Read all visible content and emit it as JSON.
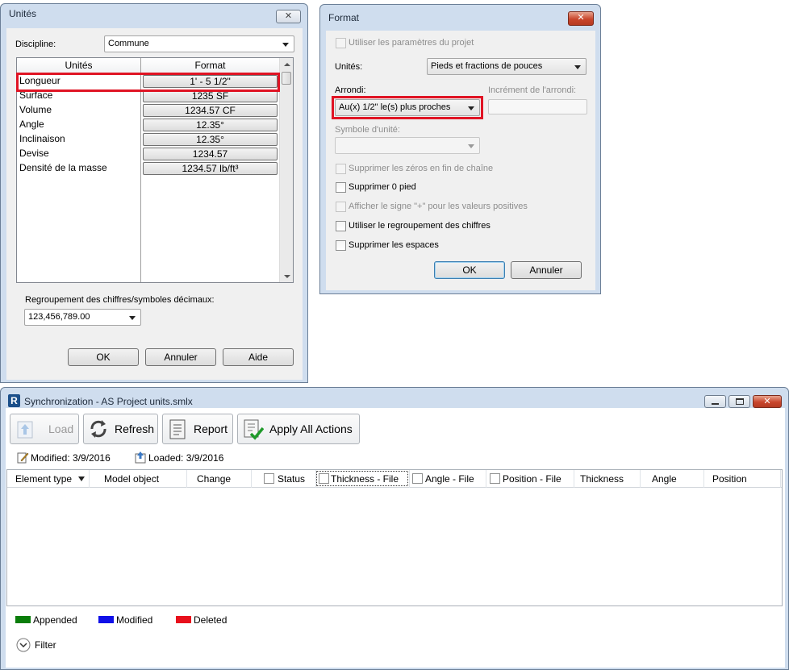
{
  "units_dialog": {
    "title": "Unités",
    "close": "✕",
    "discipline_label": "Discipline:",
    "discipline_value": "Commune",
    "columns": [
      "Unités",
      "Format"
    ],
    "rows": [
      {
        "name": "Longueur",
        "format": "1' - 5 1/2\""
      },
      {
        "name": "Surface",
        "format": "1235 SF"
      },
      {
        "name": "Volume",
        "format": "1234.57 CF"
      },
      {
        "name": "Angle",
        "format": "12.35°"
      },
      {
        "name": "Inclinaison",
        "format": "12.35°"
      },
      {
        "name": "Devise",
        "format": "1234.57"
      },
      {
        "name": "Densité de la masse",
        "format": "1234.57 lb/ft³"
      }
    ],
    "grouping_label": "Regroupement des chiffres/symboles décimaux:",
    "grouping_value": "123,456,789.00",
    "ok": "OK",
    "cancel": "Annuler",
    "help": "Aide"
  },
  "format_dialog": {
    "title": "Format",
    "close": "✕",
    "use_project": "Utiliser les paramètres du projet",
    "units_label": "Unités:",
    "units_value": "Pieds et fractions de pouces",
    "rounding_label": "Arrondi:",
    "rounding_value": "Au(x) 1/2\" le(s) plus proches",
    "increment_label": "Incrément de l'arrondi:",
    "symbol_label": "Symbole d'unité:",
    "opt_trailing": "Supprimer les zéros en fin de chaîne",
    "opt_zero_foot": "Supprimer 0 pied",
    "opt_plus": "Afficher le signe \"+\" pour les valeurs positives",
    "opt_grouping": "Utiliser le regroupement des chiffres",
    "opt_spaces": "Supprimer les espaces",
    "ok": "OK",
    "cancel": "Annuler"
  },
  "sync": {
    "app_icon": "R",
    "title": "Synchronization - AS Project units.smlx",
    "toolbar": {
      "load": "Load",
      "refresh": "Refresh",
      "report": "Report",
      "apply": "Apply All Actions"
    },
    "modified": "Modified: 3/9/2016",
    "loaded": "Loaded: 3/9/2016",
    "columns": {
      "element_type": "Element type",
      "model_object": "Model object",
      "change": "Change",
      "status": "Status",
      "thickness_file": "Thickness - File",
      "angle_file": "Angle - File",
      "position_file": "Position - File",
      "thickness": "Thickness",
      "angle": "Angle",
      "position": "Position"
    },
    "legend": [
      {
        "label": "Appended",
        "color": "#0a7d0a"
      },
      {
        "label": "Modified",
        "color": "#1010e8"
      },
      {
        "label": "Deleted",
        "color": "#e8101c"
      }
    ],
    "filter": "Filter"
  },
  "colors": {
    "highlight": "#e01424"
  }
}
